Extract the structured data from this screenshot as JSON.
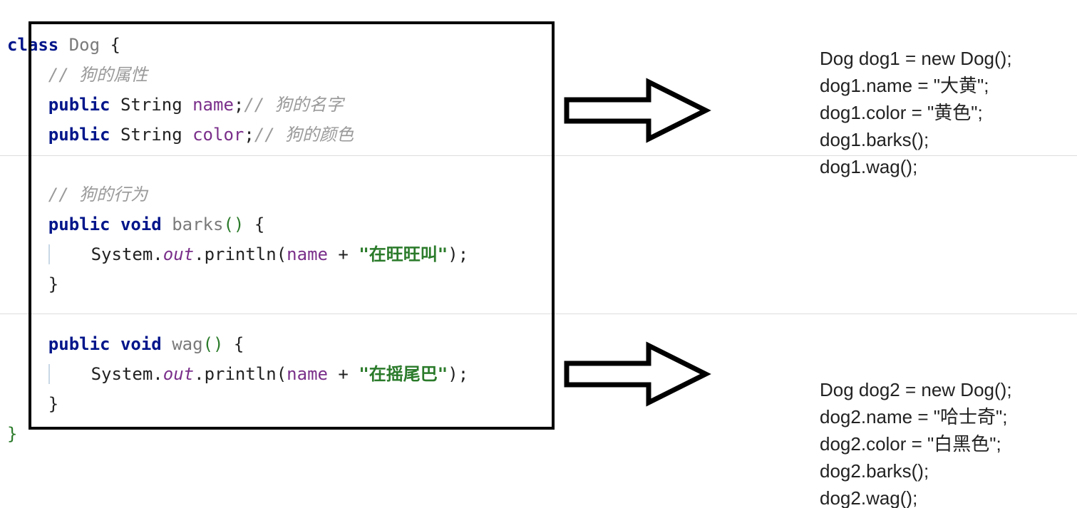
{
  "code_left": {
    "line_class_decl": {
      "kw_class": "class",
      "class_name": "Dog",
      "brace": "{"
    },
    "comment_attrs": "// 狗的属性",
    "field1": {
      "kw_public": "public",
      "type": "String",
      "name": "name",
      "semi": ";",
      "comment": "// 狗的名字"
    },
    "field2": {
      "kw_public": "public",
      "type": "String",
      "name": "color",
      "semi": ";",
      "comment": "// 狗的颜色"
    },
    "comment_behaviors": "// 狗的行为",
    "method1_sig": {
      "kw_public": "public",
      "kw_void": "void",
      "name": "barks",
      "parens": "()",
      "brace": "{"
    },
    "method1_body": {
      "sys": "System",
      "dot1": ".",
      "out": "out",
      "dot2": ".",
      "println": "println",
      "open": "(",
      "arg_name": "name",
      "plus": " + ",
      "str": "\"在旺旺叫\"",
      "close": ")",
      "semi": ";"
    },
    "method1_end": "}",
    "method2_sig": {
      "kw_public": "public",
      "kw_void": "void",
      "name": "wag",
      "parens": "()",
      "brace": "{"
    },
    "method2_body": {
      "sys": "System",
      "dot1": ".",
      "out": "out",
      "dot2": ".",
      "println": "println",
      "open": "(",
      "arg_name": "name",
      "plus": " + ",
      "str": "\"在摇尾巴\"",
      "close": ")",
      "semi": ";"
    },
    "method2_end": "}",
    "class_end": "}"
  },
  "usage1": {
    "l1": "Dog dog1 = new Dog();",
    "l2": "dog1.name = \"大黄\";",
    "l3": "dog1.color = \"黄色\";",
    "l4": "dog1.barks();",
    "l5": "dog1.wag();"
  },
  "usage2": {
    "l1": "Dog dog2 = new Dog();",
    "l2": "dog2.name = \"哈士奇\";",
    "l3": "dog2.color = \"白黑色\";",
    "l4": "dog2.barks();",
    "l5": "dog2.wag();"
  }
}
